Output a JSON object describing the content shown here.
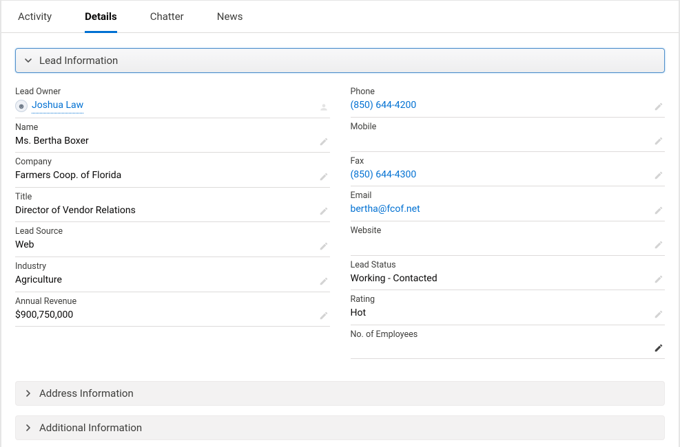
{
  "tabs": {
    "activity": "Activity",
    "details": "Details",
    "chatter": "Chatter",
    "news": "News",
    "active": "details"
  },
  "sections": {
    "lead_info": {
      "title": "Lead Information",
      "expanded": true
    },
    "address_info": {
      "title": "Address Information",
      "expanded": false
    },
    "additional_info": {
      "title": "Additional Information",
      "expanded": false
    }
  },
  "lead": {
    "owner_label": "Lead Owner",
    "owner_name": "Joshua Law",
    "name_label": "Name",
    "name_value": "Ms. Bertha Boxer",
    "company_label": "Company",
    "company_value": "Farmers Coop. of Florida",
    "title_label": "Title",
    "title_value": "Director of Vendor Relations",
    "leadsource_label": "Lead Source",
    "leadsource_value": "Web",
    "industry_label": "Industry",
    "industry_value": "Agriculture",
    "revenue_label": "Annual Revenue",
    "revenue_value": "$900,750,000",
    "phone_label": "Phone",
    "phone_value": "(850) 644-4200",
    "mobile_label": "Mobile",
    "mobile_value": "",
    "fax_label": "Fax",
    "fax_value": "(850) 644-4300",
    "email_label": "Email",
    "email_value": "bertha@fcof.net",
    "website_label": "Website",
    "website_value": "",
    "status_label": "Lead Status",
    "status_value": "Working - Contacted",
    "rating_label": "Rating",
    "rating_value": "Hot",
    "employees_label": "No. of Employees",
    "employees_value": ""
  },
  "icons": {
    "avatar_glyph": "☻"
  }
}
